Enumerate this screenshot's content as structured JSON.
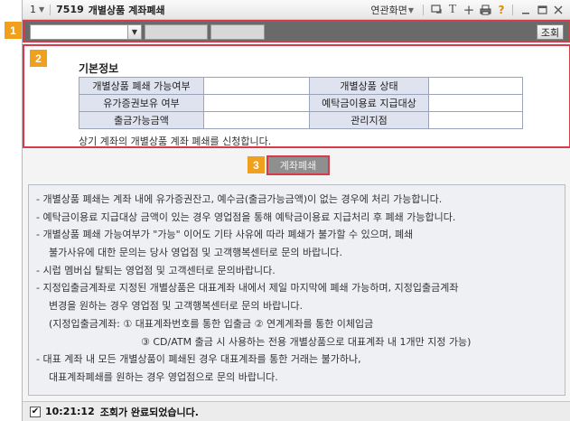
{
  "titlebar": {
    "window_number": "1",
    "screen_code": "7519",
    "screen_title": "개별상품 계좌폐쇄",
    "related_screens_label": "연관화면",
    "icons": [
      "window-link-icon",
      "text-size-icon",
      "add-icon",
      "print-icon",
      "help-icon",
      "minimize-icon",
      "maximize-icon",
      "close-icon"
    ]
  },
  "markers": {
    "search": "1",
    "info": "2",
    "close_button": "3"
  },
  "searchbar": {
    "account_select_value": "",
    "account_field_2": "",
    "account_field_3": "",
    "query_button_label": "조회"
  },
  "info": {
    "section_title": "기본정보",
    "rows": [
      {
        "label1": "개별상품 폐쇄 가능여부",
        "value1": "",
        "label2": "개별상품 상태",
        "value2": ""
      },
      {
        "label1": "유가증권보유 여부",
        "value1": "",
        "label2": "예탁금이용료 지급대상",
        "value2": ""
      },
      {
        "label1": "출금가능금액",
        "value1": "",
        "label2": "관리지점",
        "value2": ""
      }
    ],
    "apply_text": "상기 계좌의 개별상품 계좌 폐쇄를 신청합니다."
  },
  "close_button_label": "계좌폐쇄",
  "notice": [
    {
      "text": "- 개별상품 폐쇄는 계좌 내에 유가증권잔고, 예수금(출금가능금액)이 없는 경우에 처리 가능합니다.",
      "indent": ""
    },
    {
      "text": "- 예탁금이용료 지급대상 금액이 있는 경우 영업점을 통해 예탁금이용료 지급처리 후 폐쇄 가능합니다.",
      "indent": ""
    },
    {
      "text": "- 개별상품 폐쇄 가능여부가 \"가능\" 이어도 기타 사유에 따라 폐쇄가 불가할 수 있으며, 폐쇄",
      "indent": ""
    },
    {
      "text": "불가사유에 대한 문의는 당사 영업점 및 고객행복센터로 문의 바랍니다.",
      "indent": "ind"
    },
    {
      "text": "- 시럽 멤버십 탈퇴는 영업점 및 고객센터로 문의바랍니다.",
      "indent": ""
    },
    {
      "text": "- 지정입출금계좌로 지정된 개별상품은 대표계좌 내에서 제일 마지막에 폐쇄 가능하며, 지정입출금계좌",
      "indent": ""
    },
    {
      "text": "변경을 원하는 경우 영업점 및 고객행복센터로 문의 바랍니다.",
      "indent": "ind"
    },
    {
      "text": "(지정입출금계좌: ① 대표계좌번호를 통한 입출금 ② 연계계좌를 통한 이체입금",
      "indent": "ind"
    },
    {
      "text": "③ CD/ATM 출금 시 사용하는 전용 개별상품으로 대표계좌 내 1개만 지정 가능)",
      "indent": "ind2"
    },
    {
      "text": "- 대표 계좌 내 모든 개별상품이 폐쇄된 경우 대표계좌를 통한 거래는 불가하나,",
      "indent": ""
    },
    {
      "text": "대표계좌폐쇄를 원하는 경우 영업점으로 문의 바랍니다.",
      "indent": "ind"
    }
  ],
  "status": {
    "checked": "✔",
    "time": "10:21:12",
    "message": "조회가 완료되었습니다."
  }
}
